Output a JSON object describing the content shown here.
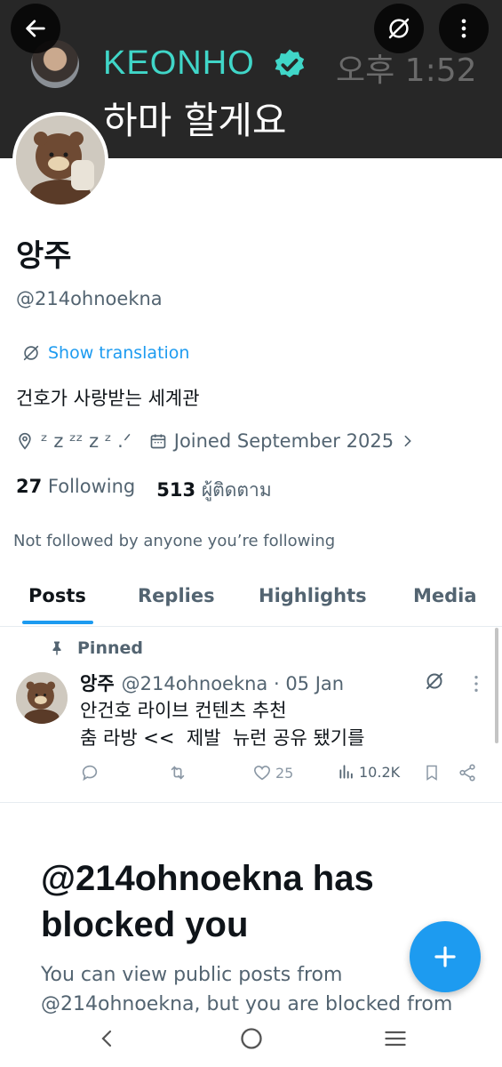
{
  "banner": {
    "name": "KEONHO",
    "time": "오후 1:52",
    "message": "하마 할게요",
    "accent_color": "#40d6c8"
  },
  "header_buttons": {
    "back_icon": "arrow-left-icon",
    "translate_icon": "translate-off-icon",
    "more_icon": "more-vertical-icon"
  },
  "profile": {
    "display_name": "앙주",
    "handle": "@214ohnoekna",
    "show_translation": "Show translation",
    "bio": "건호가 사랑받는 세계관",
    "location": "ᶻ z ᶻᶻ z ᶻ .ᐟ",
    "joined": "Joined September 2025",
    "following_count": "27",
    "following_label": "Following",
    "followers_count": "513",
    "followers_label": "ผู้ติดตาม",
    "not_followed": "Not followed by anyone you’re following"
  },
  "tabs": [
    {
      "label": "Posts",
      "active": true
    },
    {
      "label": "Replies",
      "active": false
    },
    {
      "label": "Highlights",
      "active": false
    },
    {
      "label": "Media",
      "active": false
    }
  ],
  "pinned_post": {
    "pinned_label": "Pinned",
    "author": "앙주",
    "handle_date": "@214ohnoekna · 05 Jan",
    "text": "안건호 라이브 컨텐츠 추천\n춤 라방 <<  제발  뉴런 공유 됐기를",
    "likes": "25",
    "views": "10.2K"
  },
  "blocked": {
    "title": "@214ohnoekna has blocked you",
    "body": "You can view public posts from @214ohnoekna, but you are blocked from"
  },
  "colors": {
    "accent": "#1d9bf0",
    "muted": "#536471",
    "banner_bg": "#272727"
  }
}
